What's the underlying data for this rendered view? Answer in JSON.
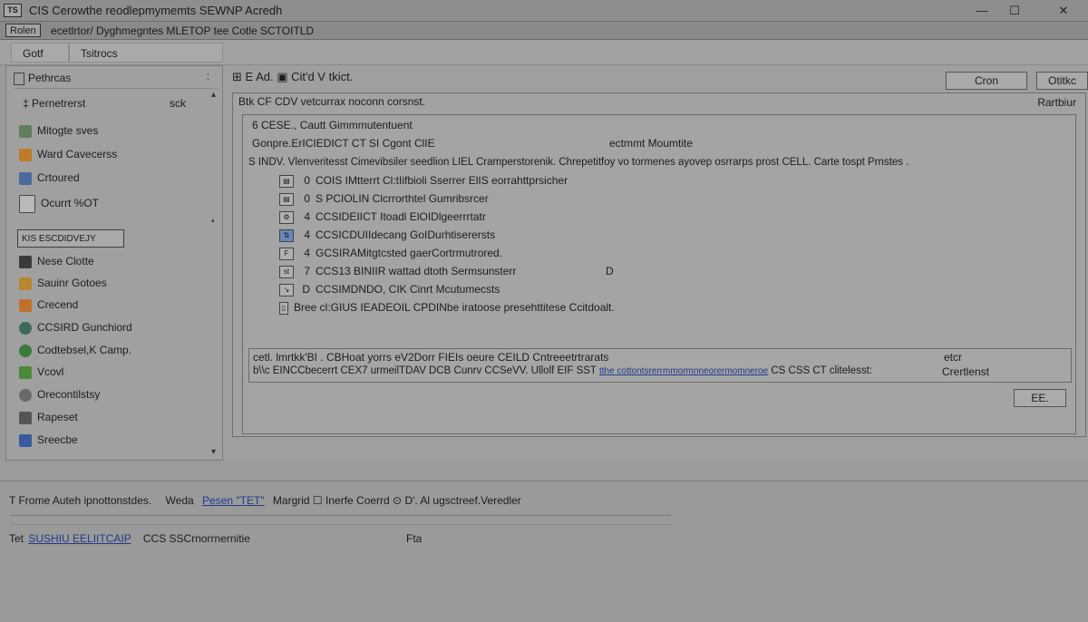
{
  "window": {
    "app_icon_text": "TS",
    "title": "CIS Cerowthe reodlepmymemts SEWNP Acredh",
    "controls": [
      "—",
      "☐",
      "✕"
    ]
  },
  "menubar": {
    "first": "Rolen",
    "rest": "ecetlrtor/ Dyghmegntes MLETOP tee Cotle SCTOITLD"
  },
  "tabs": [
    "Gotf",
    "Tsitrocs"
  ],
  "sidebar": {
    "header1": "Pethrcas",
    "header2": "Pernetrerst",
    "header2_right": "sck",
    "items": [
      {
        "label": "Mitogte sves",
        "icon": "wrench-icon",
        "color": "#5f7f5f"
      },
      {
        "label": "Ward Cavecerss",
        "icon": "flame-icon",
        "color": "#c07a2a"
      },
      {
        "label": "Crtoured",
        "icon": "chart-icon",
        "color": "#4a6aa0"
      },
      {
        "label": "Ocurrt %OT",
        "icon": "document-icon",
        "color": "#8a8a8a"
      }
    ],
    "selected_box": "KIS ESCDIDVEJY",
    "items2": [
      {
        "label": "Nese Clotte",
        "icon": "book-icon",
        "color": "#3a3a3a"
      },
      {
        "label": "Sauinr Gotoes",
        "icon": "folder-icon",
        "color": "#b8862e"
      },
      {
        "label": "Crecend",
        "icon": "folder-open-icon",
        "color": "#c2702a"
      },
      {
        "label": "CCSIRD Gunchiord",
        "icon": "gear-icon",
        "color": "#3c6a5a"
      },
      {
        "label": "Codtebsel,K Camp.",
        "icon": "globe-icon",
        "color": "#3a7a3a"
      },
      {
        "label": "Vcovl",
        "icon": "leaf-icon",
        "color": "#4a8a3a"
      },
      {
        "label": "Orecontilstsy",
        "icon": "clock-icon",
        "color": "#6a6a6a"
      },
      {
        "label": "Rapeset",
        "icon": "print-icon",
        "color": "#555555"
      },
      {
        "label": "Sreecbe",
        "icon": "database-icon",
        "color": "#3a5aa0"
      }
    ]
  },
  "toolbar": {
    "text": "⊞ E Ad. ▣ Cit'd   V    tkict.",
    "btn_right1": "Cron",
    "btn_right2": "Otitkc"
  },
  "content": {
    "header": "Btk CF CDV   vetcurrax noconn corsnst.",
    "right_label": "Rartbiur",
    "line1": "6 CESE.,   Cautt Gimmmutentuent",
    "line2_left": "Gonpre.ErICIEDICT CT   SI Cgont ClIE",
    "line2_right": "ectmmt Moumtite",
    "tree_root": "S  INDV.   Vlenveritesst Cimevibsiler seedlion LIEL Cramperstorenik. Chrepetitfoy vo tormenes ayovep osrrarps prost CELL. Carte tospt Prnstes .",
    "tree": [
      {
        "num": "0",
        "text": "COIS IMtterrt Cl:tIifbioli Sserrer ElIS eorrahttprsicher",
        "right": ""
      },
      {
        "num": "0",
        "text": "S PCIOLIN Clcrrorthtel Gumribsrcer",
        "right": ""
      },
      {
        "num": "4",
        "text": "CCSIDEIICT Itoadl ElOIDlgeerrrtatr",
        "right": ""
      },
      {
        "num": "4",
        "text": "CCSICDUIIdecang GoIDurhtiserersts",
        "right": ""
      },
      {
        "num": "4",
        "text": "GCSIRAMitgtcsted gaerCortrmutrored.",
        "right": ""
      },
      {
        "num": "7",
        "text": "CCS13 BINIIR wattad dtoth Sermsunsterr",
        "right": "D"
      },
      {
        "num": "D",
        "text": "CCSIMDNDO, CIK   Cinrt Mcutumecsts",
        "right": ""
      },
      {
        "num": "",
        "text": "Bree   cl:GIUS IEADEOIL CPDINbe iratoose presehttitese Ccitdoalt.",
        "right": ""
      }
    ],
    "summary_line1": "cetl. lmrtkk'BI .   CBHoat yorrs eV2Dorr FIEIs oeure CEILD Cntreeetrtrarats",
    "summary_line1_right": "etcr",
    "summary_line2_left": "b\\\\c EINCCbecerrt CEX7 urmeilTDAV DCB Cunrv CCSeVV. Ullolf EIF SST",
    "summary_link": "tthe cottontsrerrmmormnneorermomneroe",
    "summary_line2_mid": "CS CSS CT clitelesst:",
    "summary_line2_right": "Crertlenst",
    "page_btn": "EE."
  },
  "bottom": {
    "line1_a": "T   Frome Auteh ipnottonstdes.",
    "line1_b": "Weda",
    "line1_link": "Pesen \"TET\"",
    "line1_c": "Margrid ☐ Inerfe Coerrd ⊙ D'.  Al   ugsctreef.Veredler",
    "line2_a": "Tet",
    "line2_link": "SUSHIU EELIITCAIP",
    "line2_b": "CCS SSCrnorrnernitie",
    "line2_right": "Fta"
  }
}
